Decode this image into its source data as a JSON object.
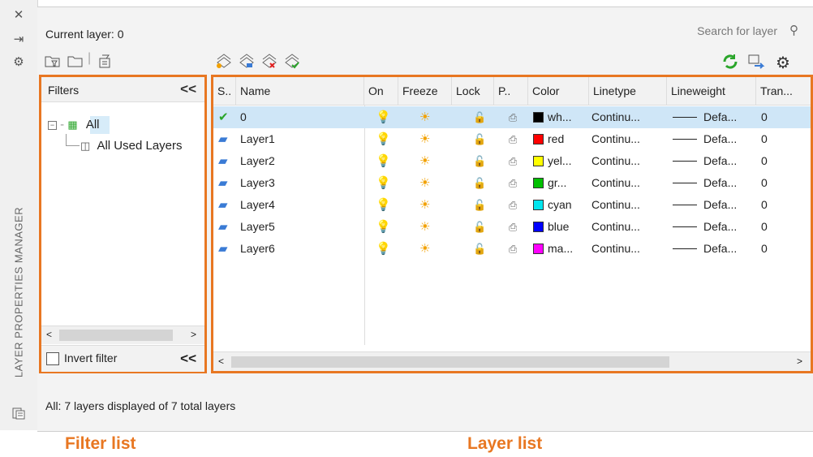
{
  "sidebar": {
    "title": "LAYER PROPERTIES MANAGER",
    "close_glyph": "✕",
    "autohide_glyph": "⇥",
    "settings_glyph": "⚙"
  },
  "header": {
    "current_layer_label": "Current layer: 0",
    "search_placeholder": "Search for layer",
    "search_icon": "search-icon"
  },
  "filter_pane": {
    "title": "Filters",
    "collapse_glyph": "<<",
    "tree": {
      "root_label": "All",
      "child_label": "All Used Layers"
    },
    "scroll_left": "<",
    "scroll_right": ">",
    "invert_label": "Invert filter",
    "invert_checked": false,
    "footer_collapse_glyph": "<<"
  },
  "layer_list": {
    "columns": [
      "S..",
      "Name",
      "On",
      "Freeze",
      "Lock",
      "P..",
      "Color",
      "Linetype",
      "Lineweight",
      "Tran..."
    ],
    "rows": [
      {
        "status": "current",
        "name": "0",
        "color_name": "wh...",
        "color_hex": "#000000",
        "linetype": "Continu...",
        "lineweight": "Defa...",
        "transparency": "0",
        "selected": true
      },
      {
        "status": "layer",
        "name": "Layer1",
        "color_name": "red",
        "color_hex": "#ff0000",
        "linetype": "Continu...",
        "lineweight": "Defa...",
        "transparency": "0",
        "selected": false
      },
      {
        "status": "layer",
        "name": "Layer2",
        "color_name": "yel...",
        "color_hex": "#ffff00",
        "linetype": "Continu...",
        "lineweight": "Defa...",
        "transparency": "0",
        "selected": false
      },
      {
        "status": "layer",
        "name": "Layer3",
        "color_name": "gr...",
        "color_hex": "#00c000",
        "linetype": "Continu...",
        "lineweight": "Defa...",
        "transparency": "0",
        "selected": false
      },
      {
        "status": "layer",
        "name": "Layer4",
        "color_name": "cyan",
        "color_hex": "#00e5ee",
        "linetype": "Continu...",
        "lineweight": "Defa...",
        "transparency": "0",
        "selected": false
      },
      {
        "status": "layer",
        "name": "Layer5",
        "color_name": "blue",
        "color_hex": "#0000ff",
        "linetype": "Continu...",
        "lineweight": "Defa...",
        "transparency": "0",
        "selected": false
      },
      {
        "status": "layer",
        "name": "Layer6",
        "color_name": "ma...",
        "color_hex": "#ff00ff",
        "linetype": "Continu...",
        "lineweight": "Defa...",
        "transparency": "0",
        "selected": false
      }
    ],
    "scroll_left": "<",
    "scroll_right": ">"
  },
  "status_bar": {
    "text": "All: 7 layers displayed of 7 total layers"
  },
  "callouts": {
    "filter_list": "Filter list",
    "layer_list": "Layer list"
  },
  "colors": {
    "accent_outline": "#e87722",
    "selection": "#cfe6f7",
    "current_check": "#2aa52a",
    "layer_icon": "#3a7bd5"
  },
  "icons": {
    "on": "lightbulb-icon",
    "freeze": "sun-icon",
    "lock": "unlocked-padlock-icon",
    "plot": "printer-icon"
  }
}
